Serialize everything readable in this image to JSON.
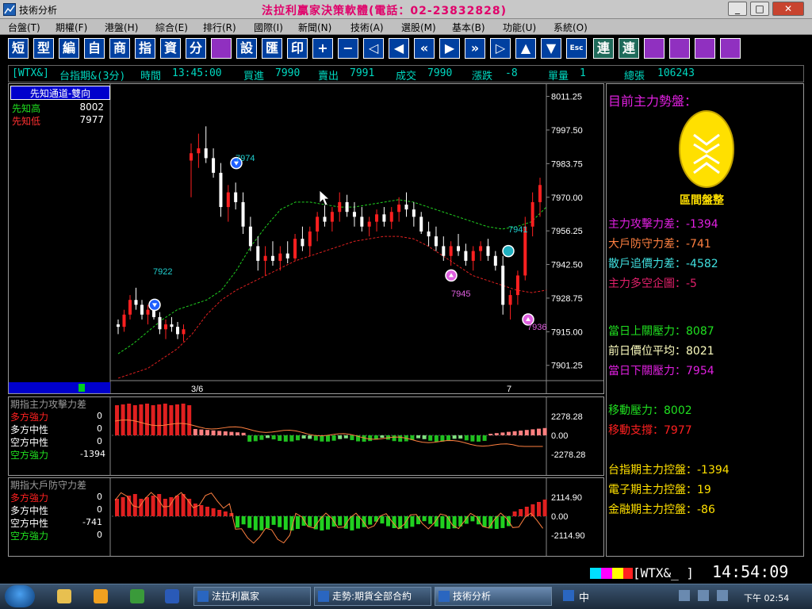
{
  "window": {
    "title": "技術分析",
    "banner": "法拉利贏家決策軟體(電話：02-23832828)"
  },
  "menu": [
    "台盤(T)",
    "期權(F)",
    "港盤(H)",
    "綜合(E)",
    "排行(R)",
    "國際(I)",
    "新聞(N)",
    "技術(A)",
    "選股(M)",
    "基本(B)",
    "功能(U)",
    "系統(O)"
  ],
  "toolbar": [
    "短",
    "型",
    "編",
    "自",
    "商",
    "指",
    "資",
    "分",
    "",
    "設",
    "匯",
    "印",
    "+",
    "−",
    "◁",
    "◀",
    "«",
    "▶",
    "»",
    "▷",
    "▲",
    "▼",
    "Esc",
    "連",
    "連",
    "",
    "",
    "",
    ""
  ],
  "quote": {
    "symbol": "[WTX&]",
    "name": "台指期&(3分)",
    "time_label": "時間",
    "time": "13:45:00",
    "bid_label": "買進",
    "bid": "7990",
    "ask_label": "賣出",
    "ask": "7991",
    "last_label": "成交",
    "last": "7990",
    "change_label": "漲跌",
    "change": "-8",
    "volume_label": "單量",
    "volume": "1",
    "total_label": "總張",
    "total": "106243"
  },
  "main_chart": {
    "legend_title": "先知通道-雙向",
    "high_label": "先知高",
    "high_value": "8002",
    "low_label": "先知低",
    "low_value": "7977",
    "y_ticks": [
      "8011.25",
      "7997.50",
      "7983.75",
      "7970.00",
      "7956.25",
      "7942.50",
      "7928.75",
      "7915.00",
      "7901.25"
    ],
    "x_labels": [
      "3/6",
      "7"
    ],
    "markers": [
      "7922",
      "7974",
      "7945",
      "7941",
      "7936"
    ]
  },
  "chart_data": {
    "type": "candlestick",
    "ylim": [
      7895,
      8015
    ],
    "candles": [
      [
        7918,
        7920,
        7914,
        7917
      ],
      [
        7917,
        7924,
        7915,
        7922
      ],
      [
        7922,
        7930,
        7920,
        7928
      ],
      [
        7928,
        7933,
        7924,
        7926
      ],
      [
        7926,
        7928,
        7920,
        7922
      ],
      [
        7922,
        7926,
        7918,
        7924
      ],
      [
        7924,
        7927,
        7920,
        7921
      ],
      [
        7921,
        7923,
        7914,
        7916
      ],
      [
        7916,
        7920,
        7912,
        7918
      ],
      [
        7918,
        7921,
        7915,
        7917
      ],
      [
        7917,
        7919,
        7912,
        7914
      ],
      [
        7914,
        7918,
        7911,
        7916
      ],
      [
        7985,
        7992,
        7970,
        7988
      ],
      [
        7988,
        7996,
        7982,
        7990
      ],
      [
        7990,
        7999,
        7984,
        7986
      ],
      [
        7986,
        7990,
        7978,
        7980
      ],
      [
        7980,
        7984,
        7962,
        7966
      ],
      [
        7966,
        7975,
        7960,
        7972
      ],
      [
        7972,
        7976,
        7965,
        7968
      ],
      [
        7968,
        7972,
        7955,
        7958
      ],
      [
        7958,
        7962,
        7948,
        7950
      ],
      [
        7950,
        7954,
        7940,
        7944
      ],
      [
        7944,
        7950,
        7938,
        7946
      ],
      [
        7946,
        7952,
        7942,
        7944
      ],
      [
        7944,
        7950,
        7940,
        7947
      ],
      [
        7947,
        7952,
        7943,
        7945
      ],
      [
        7945,
        7955,
        7944,
        7953
      ],
      [
        7953,
        7958,
        7948,
        7950
      ],
      [
        7950,
        7958,
        7946,
        7956
      ],
      [
        7956,
        7964,
        7952,
        7962
      ],
      [
        7962,
        7968,
        7958,
        7960
      ],
      [
        7960,
        7966,
        7956,
        7964
      ],
      [
        7964,
        7972,
        7960,
        7968
      ],
      [
        7968,
        7971,
        7962,
        7964
      ],
      [
        7964,
        7968,
        7958,
        7962
      ],
      [
        7962,
        7966,
        7956,
        7958
      ],
      [
        7958,
        7962,
        7954,
        7960
      ],
      [
        7960,
        7965,
        7956,
        7963
      ],
      [
        7963,
        7966,
        7958,
        7960
      ],
      [
        7960,
        7966,
        7957,
        7964
      ],
      [
        7964,
        7970,
        7960,
        7967
      ],
      [
        7967,
        7972,
        7962,
        7965
      ],
      [
        7965,
        7968,
        7958,
        7962
      ],
      [
        7962,
        7964,
        7955,
        7956
      ],
      [
        7956,
        7960,
        7950,
        7954
      ],
      [
        7954,
        7958,
        7948,
        7950
      ],
      [
        7950,
        7954,
        7944,
        7946
      ],
      [
        7946,
        7952,
        7942,
        7950
      ],
      [
        7950,
        7955,
        7946,
        7948
      ],
      [
        7948,
        7951,
        7942,
        7944
      ],
      [
        7944,
        7950,
        7940,
        7948
      ],
      [
        7948,
        7952,
        7944,
        7950
      ],
      [
        7950,
        7953,
        7944,
        7946
      ],
      [
        7946,
        7948,
        7940,
        7942
      ],
      [
        7942,
        7946,
        7922,
        7926
      ],
      [
        7926,
        7932,
        7920,
        7930
      ],
      [
        7930,
        7940,
        7926,
        7938
      ],
      [
        7938,
        7962,
        7936,
        7958
      ],
      [
        7958,
        7972,
        7954,
        7968
      ],
      [
        7968,
        7978,
        7962,
        7975
      ]
    ],
    "channel_upper": [
      7906,
      7910,
      7915,
      7920,
      7924,
      7926,
      7928,
      7932,
      7940,
      7950,
      7958,
      7965,
      7968,
      7968,
      7967,
      7966,
      7966,
      7967,
      7968,
      7969,
      7968,
      7966,
      7964,
      7962,
      7960,
      7958,
      7957,
      7958,
      7960,
      7966
    ],
    "channel_lower": [
      7896,
      7898,
      7900,
      7904,
      7908,
      7914,
      7922,
      7928,
      7932,
      7935,
      7938,
      7941,
      7944,
      7946,
      7948,
      7950,
      7952,
      7953,
      7954,
      7954,
      7953,
      7950,
      7946,
      7942,
      7938,
      7936,
      7934,
      7932,
      7931,
      7932
    ]
  },
  "indicator1": {
    "title": "期指主力攻擊力差",
    "rows": [
      {
        "label": "多方強力",
        "value": "0",
        "color": "#ff2020"
      },
      {
        "label": "多方中性",
        "value": "0",
        "color": "#ffffff"
      },
      {
        "label": "空方中性",
        "value": "0",
        "color": "#ffffff"
      },
      {
        "label": "空方強力",
        "value": "-1394",
        "color": "#20e020"
      }
    ],
    "y_ticks": [
      "2278.28",
      "0.00",
      "-2278.28"
    ]
  },
  "indicator2": {
    "title": "期指大戶防守力差",
    "rows": [
      {
        "label": "多方強力",
        "value": "0",
        "color": "#ff2020"
      },
      {
        "label": "多方中性",
        "value": "0",
        "color": "#ffffff"
      },
      {
        "label": "空方中性",
        "value": "-741",
        "color": "#ffffff"
      },
      {
        "label": "空方強力",
        "value": "0",
        "color": "#20e020"
      }
    ],
    "y_ticks": [
      "2114.90",
      "0.00",
      "-2114.90"
    ]
  },
  "side": {
    "title": "目前主力勢盤：",
    "status": "區間盤整",
    "attack_label": "主力攻擊力差：",
    "attack": "-1394",
    "defense_label": "大戶防守力差：",
    "defense": "-741",
    "retail_label": "散戶追價力差：",
    "retail": "-4582",
    "intent_label": "主力多空企圖：",
    "intent": "-5",
    "upper_press_label": "當日上關壓力：",
    "upper_press": "8087",
    "prev_avg_label": "前日價位平均：",
    "prev_avg": "8021",
    "lower_press_label": "當日下關壓力：",
    "lower_press": "7954",
    "move_press_label": "移動壓力：",
    "move_press": "8002",
    "move_support_label": "移動支撐：",
    "move_support": "7977",
    "tx_ctrl_label": "台指期主力控盤：",
    "tx_ctrl": "-1394",
    "te_ctrl_label": "電子期主力控盤：",
    "te_ctrl": "19",
    "tf_ctrl_label": "金融期主力控盤：",
    "tf_ctrl": "-86"
  },
  "status": {
    "symbol": "[WTX&_ ]",
    "clock": "14:54:09"
  },
  "taskbar": {
    "tasks": [
      "法拉利贏家",
      "走勢:期貨全部合約",
      "技術分析"
    ],
    "time": "下午 02:54"
  }
}
